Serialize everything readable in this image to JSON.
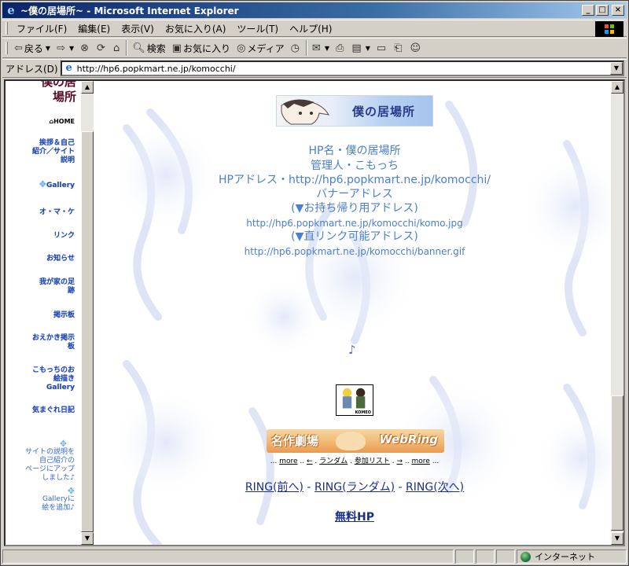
{
  "window": {
    "title": "~僕の居場所~ - Microsoft Internet Explorer",
    "controls": {
      "minimize": "_",
      "maximize": "□",
      "close": "×"
    }
  },
  "menu": [
    "ファイル(F)",
    "編集(E)",
    "表示(V)",
    "お気に入り(A)",
    "ツール(T)",
    "ヘルプ(H)"
  ],
  "toolbar": {
    "back": "戻る",
    "search": "検索",
    "favorites": "お気に入り",
    "media": "メディア"
  },
  "address": {
    "label": "アドレス(D)",
    "url": "http://hp6.popkmart.ne.jp/komocchi/"
  },
  "sidebar": {
    "title_line1": "僕の居",
    "title_line2": "場所",
    "items": [
      {
        "label": "HOME"
      },
      {
        "label_l1": "挨拶＆自己",
        "label_l2": "紹介／サイト",
        "label_l3": "説明"
      },
      {
        "label": "Gallery"
      },
      {
        "label": "オ・マ・ケ"
      },
      {
        "label": "リンク"
      },
      {
        "label": "お知らせ"
      },
      {
        "label_l1": "我が家の足",
        "label_l2": "跡"
      },
      {
        "label": "掲示板"
      },
      {
        "label_l1": "おえかき掲示",
        "label_l2": "板"
      },
      {
        "label_l1": "こもっちのお",
        "label_l2": "絵描き",
        "label_l3": "Gallery"
      },
      {
        "label": "気まぐれ日記"
      }
    ],
    "notes": [
      {
        "l1": "サイトの説明を",
        "l2": "自己紹介の",
        "l3": "ページにアップ",
        "l4": "しました♪"
      },
      {
        "l1": "Galleryに",
        "l2": "絵を追加♪"
      }
    ]
  },
  "main": {
    "banner_title": "僕の居場所",
    "info_lines": [
      "HP名・僕の居場所",
      "管理人・こもっち",
      "HPアドレス・http://hp6.popkmart.ne.jp/komocchi/",
      "バナーアドレス",
      "(▼お持ち帰り用アドレス)",
      "http://hp6.popkmart.ne.jp/komocchi/komo.jpg",
      "(▼直リンク可能アドレス)",
      "http://hp6.popkmart.ne.jp/komocchi/banner.gif"
    ],
    "music_note": "♪",
    "avatar_caption": "KOMEO",
    "webring": {
      "left": "名作劇場",
      "right": "WebRing"
    },
    "ringnav": {
      "pre": "...",
      "more1": "more",
      "prev": "←",
      "random": "ランダム",
      "list": "参加リスト",
      "next": "→",
      "more2": "more",
      "post": "..."
    },
    "ring_links": {
      "prev": "RING(前へ)",
      "random": "RING(ランダム)",
      "next": "RING(次へ)",
      "sep": "-"
    },
    "free_hp": "無料HP"
  },
  "status": {
    "text": "",
    "zone": "インターネット"
  }
}
